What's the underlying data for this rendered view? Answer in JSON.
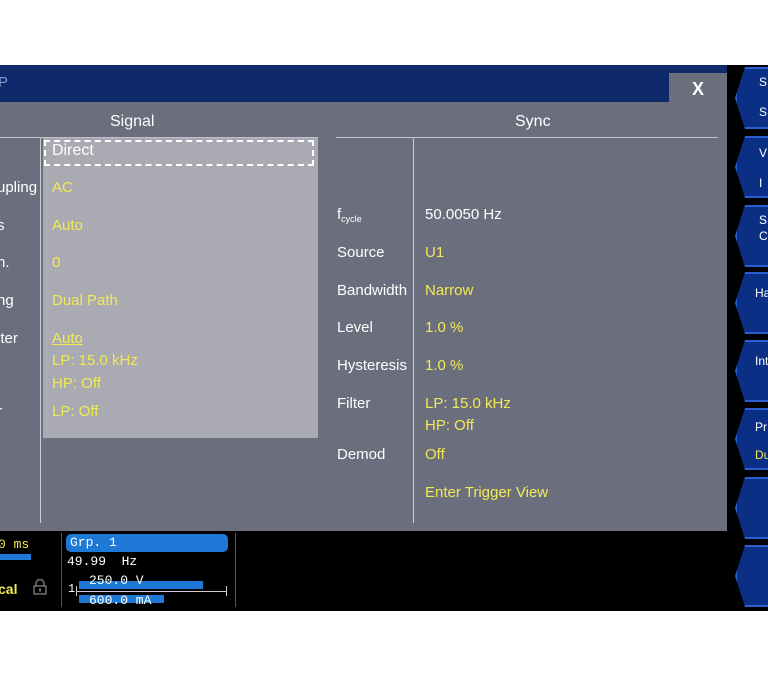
{
  "window": {
    "title_fragment": "P",
    "close_label": "X"
  },
  "signal": {
    "header": "Signal",
    "selected_value": "Direct",
    "rows": [
      {
        "label": "upling",
        "value": "AC"
      },
      {
        "label": "s",
        "value": "Auto"
      },
      {
        "label": "n.",
        "value": "0"
      },
      {
        "label": "ng",
        "value": "Dual Path"
      },
      {
        "label": "lter",
        "value": "Auto",
        "value2": "LP: 15.0 kHz",
        "value3": "HP: Off"
      },
      {
        "label": "r",
        "value": "LP: Off"
      }
    ]
  },
  "sync": {
    "header": "Sync",
    "fcycle_label": "f",
    "fcycle_sub": "cycle",
    "fcycle_value": "50.0050 Hz",
    "rows": [
      {
        "label": "Source",
        "value": "U1"
      },
      {
        "label": "Bandwidth",
        "value": "Narrow"
      },
      {
        "label": "Level",
        "value": "1.0 %"
      },
      {
        "label": "Hysteresis",
        "value": "1.0 %"
      },
      {
        "label": "Filter",
        "value": "LP: 15.0 kHz",
        "value2": "HP: Off"
      },
      {
        "label": "Demod",
        "value": "Off"
      }
    ],
    "trigger_link": "Enter Trigger View"
  },
  "softkeys": [
    {
      "line1": "S",
      "line2": "S"
    },
    {
      "line1": "V",
      "line2": "I"
    },
    {
      "line1": "S",
      "line2": "C"
    },
    {
      "line1": "Ha",
      "line2": ""
    },
    {
      "line1": "Int",
      "line2": ""
    },
    {
      "line1": "Pr",
      "line2": "Du"
    },
    {
      "line1": "",
      "line2": ""
    },
    {
      "line1": "",
      "line2": ""
    }
  ],
  "status": {
    "time_fragment": "0 ms",
    "local_fragment": "cal",
    "group_label": "Grp. 1",
    "freq_value": "49.99",
    "freq_unit": "Hz",
    "channel_num": "1",
    "voltage": "250.0 V",
    "current": "600.0 mA",
    "accent": "#1e78d6",
    "value_color": "#f2ea55"
  }
}
